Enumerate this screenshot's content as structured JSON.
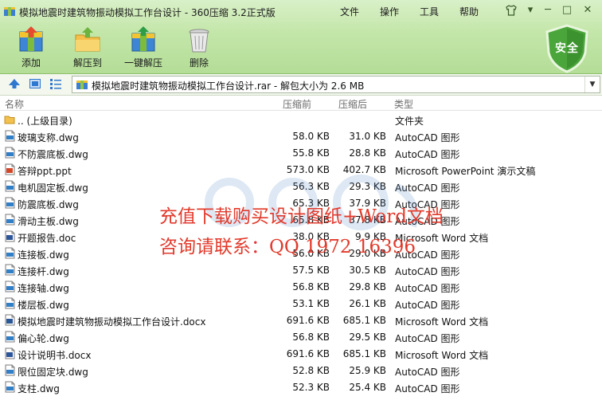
{
  "window": {
    "title": "模拟地震时建筑物振动模拟工作台设计 - 360压缩 3.2正式版",
    "menu": [
      "文件",
      "操作",
      "工具",
      "帮助"
    ]
  },
  "toolbar": {
    "add_label": "添加",
    "extract_label": "解压到",
    "one_click_label": "一键解压",
    "delete_label": "删除",
    "security_badge": "安全"
  },
  "address": {
    "path": "模拟地震时建筑物振动模拟工作台设计.rar - 解包大小为 2.6 MB"
  },
  "columns": [
    "名称",
    "压缩前",
    "压缩后",
    "类型"
  ],
  "rows": [
    {
      "name": ".. (上级目录)",
      "compressed_before": "",
      "compressed_after": "",
      "type": "文件夹",
      "icon": "folder-icon"
    },
    {
      "name": "玻璃支称.dwg",
      "compressed_before": "58.0 KB",
      "compressed_after": "31.0 KB",
      "type": "AutoCAD 图形",
      "icon": "dwg-file-icon"
    },
    {
      "name": "不防震底板.dwg",
      "compressed_before": "55.8 KB",
      "compressed_after": "28.8 KB",
      "type": "AutoCAD 图形",
      "icon": "dwg-file-icon"
    },
    {
      "name": "答辩ppt.ppt",
      "compressed_before": "573.0 KB",
      "compressed_after": "402.7 KB",
      "type": "Microsoft PowerPoint 演示文稿",
      "icon": "ppt-file-icon"
    },
    {
      "name": "电机固定板.dwg",
      "compressed_before": "56.3 KB",
      "compressed_after": "29.3 KB",
      "type": "AutoCAD 图形",
      "icon": "dwg-file-icon"
    },
    {
      "name": "防震底板.dwg",
      "compressed_before": "65.3 KB",
      "compressed_after": "37.9 KB",
      "type": "AutoCAD 图形",
      "icon": "dwg-file-icon"
    },
    {
      "name": "滑动主板.dwg",
      "compressed_before": "65.8 KB",
      "compressed_after": "37.8 KB",
      "type": "AutoCAD 图形",
      "icon": "dwg-file-icon"
    },
    {
      "name": "开题报告.doc",
      "compressed_before": "38.0 KB",
      "compressed_after": "9.9 KB",
      "type": "Microsoft Word 文档",
      "icon": "doc-file-icon"
    },
    {
      "name": "连接板.dwg",
      "compressed_before": "56.0 KB",
      "compressed_after": "29.0 KB",
      "type": "AutoCAD 图形",
      "icon": "dwg-file-icon"
    },
    {
      "name": "连接杆.dwg",
      "compressed_before": "57.5 KB",
      "compressed_after": "30.5 KB",
      "type": "AutoCAD 图形",
      "icon": "dwg-file-icon"
    },
    {
      "name": "连接轴.dwg",
      "compressed_before": "56.8 KB",
      "compressed_after": "29.8 KB",
      "type": "AutoCAD 图形",
      "icon": "dwg-file-icon"
    },
    {
      "name": "楼层板.dwg",
      "compressed_before": "53.1 KB",
      "compressed_after": "26.1 KB",
      "type": "AutoCAD 图形",
      "icon": "dwg-file-icon"
    },
    {
      "name": "模拟地震时建筑物振动模拟工作台设计.docx",
      "compressed_before": "691.6 KB",
      "compressed_after": "685.1 KB",
      "type": "Microsoft Word 文档",
      "icon": "doc-file-icon"
    },
    {
      "name": "偏心轮.dwg",
      "compressed_before": "56.8 KB",
      "compressed_after": "29.5 KB",
      "type": "AutoCAD 图形",
      "icon": "dwg-file-icon"
    },
    {
      "name": "设计说明书.docx",
      "compressed_before": "691.6 KB",
      "compressed_after": "685.1 KB",
      "type": "Microsoft Word 文档",
      "icon": "doc-file-icon"
    },
    {
      "name": "限位固定块.dwg",
      "compressed_before": "52.8 KB",
      "compressed_after": "25.9 KB",
      "type": "AutoCAD 图形",
      "icon": "dwg-file-icon"
    },
    {
      "name": "支柱.dwg",
      "compressed_before": "52.3 KB",
      "compressed_after": "25.4 KB",
      "type": "AutoCAD 图形",
      "icon": "dwg-file-icon"
    }
  ],
  "watermark": {
    "line1": "充值下载购买设计图纸+Word文档",
    "line2": "咨询请联系：QQ 1972 16396"
  }
}
